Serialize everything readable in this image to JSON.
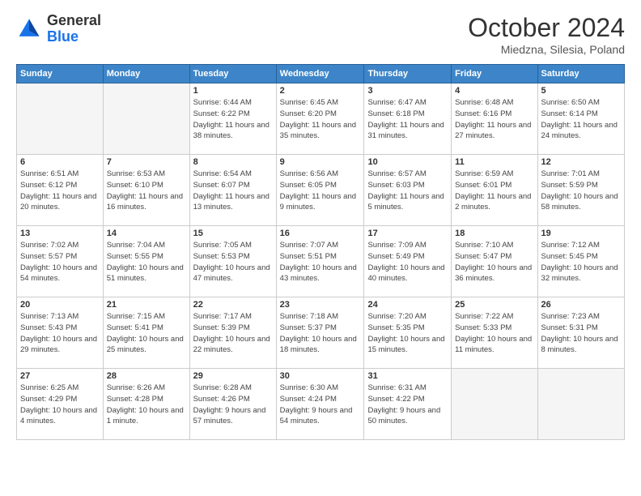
{
  "header": {
    "logo_general": "General",
    "logo_blue": "Blue",
    "month": "October 2024",
    "location": "Miedzna, Silesia, Poland"
  },
  "days_of_week": [
    "Sunday",
    "Monday",
    "Tuesday",
    "Wednesday",
    "Thursday",
    "Friday",
    "Saturday"
  ],
  "weeks": [
    [
      {
        "day": "",
        "empty": true
      },
      {
        "day": "",
        "empty": true
      },
      {
        "day": "1",
        "sunrise": "Sunrise: 6:44 AM",
        "sunset": "Sunset: 6:22 PM",
        "daylight": "Daylight: 11 hours and 38 minutes."
      },
      {
        "day": "2",
        "sunrise": "Sunrise: 6:45 AM",
        "sunset": "Sunset: 6:20 PM",
        "daylight": "Daylight: 11 hours and 35 minutes."
      },
      {
        "day": "3",
        "sunrise": "Sunrise: 6:47 AM",
        "sunset": "Sunset: 6:18 PM",
        "daylight": "Daylight: 11 hours and 31 minutes."
      },
      {
        "day": "4",
        "sunrise": "Sunrise: 6:48 AM",
        "sunset": "Sunset: 6:16 PM",
        "daylight": "Daylight: 11 hours and 27 minutes."
      },
      {
        "day": "5",
        "sunrise": "Sunrise: 6:50 AM",
        "sunset": "Sunset: 6:14 PM",
        "daylight": "Daylight: 11 hours and 24 minutes."
      }
    ],
    [
      {
        "day": "6",
        "sunrise": "Sunrise: 6:51 AM",
        "sunset": "Sunset: 6:12 PM",
        "daylight": "Daylight: 11 hours and 20 minutes."
      },
      {
        "day": "7",
        "sunrise": "Sunrise: 6:53 AM",
        "sunset": "Sunset: 6:10 PM",
        "daylight": "Daylight: 11 hours and 16 minutes."
      },
      {
        "day": "8",
        "sunrise": "Sunrise: 6:54 AM",
        "sunset": "Sunset: 6:07 PM",
        "daylight": "Daylight: 11 hours and 13 minutes."
      },
      {
        "day": "9",
        "sunrise": "Sunrise: 6:56 AM",
        "sunset": "Sunset: 6:05 PM",
        "daylight": "Daylight: 11 hours and 9 minutes."
      },
      {
        "day": "10",
        "sunrise": "Sunrise: 6:57 AM",
        "sunset": "Sunset: 6:03 PM",
        "daylight": "Daylight: 11 hours and 5 minutes."
      },
      {
        "day": "11",
        "sunrise": "Sunrise: 6:59 AM",
        "sunset": "Sunset: 6:01 PM",
        "daylight": "Daylight: 11 hours and 2 minutes."
      },
      {
        "day": "12",
        "sunrise": "Sunrise: 7:01 AM",
        "sunset": "Sunset: 5:59 PM",
        "daylight": "Daylight: 10 hours and 58 minutes."
      }
    ],
    [
      {
        "day": "13",
        "sunrise": "Sunrise: 7:02 AM",
        "sunset": "Sunset: 5:57 PM",
        "daylight": "Daylight: 10 hours and 54 minutes."
      },
      {
        "day": "14",
        "sunrise": "Sunrise: 7:04 AM",
        "sunset": "Sunset: 5:55 PM",
        "daylight": "Daylight: 10 hours and 51 minutes."
      },
      {
        "day": "15",
        "sunrise": "Sunrise: 7:05 AM",
        "sunset": "Sunset: 5:53 PM",
        "daylight": "Daylight: 10 hours and 47 minutes."
      },
      {
        "day": "16",
        "sunrise": "Sunrise: 7:07 AM",
        "sunset": "Sunset: 5:51 PM",
        "daylight": "Daylight: 10 hours and 43 minutes."
      },
      {
        "day": "17",
        "sunrise": "Sunrise: 7:09 AM",
        "sunset": "Sunset: 5:49 PM",
        "daylight": "Daylight: 10 hours and 40 minutes."
      },
      {
        "day": "18",
        "sunrise": "Sunrise: 7:10 AM",
        "sunset": "Sunset: 5:47 PM",
        "daylight": "Daylight: 10 hours and 36 minutes."
      },
      {
        "day": "19",
        "sunrise": "Sunrise: 7:12 AM",
        "sunset": "Sunset: 5:45 PM",
        "daylight": "Daylight: 10 hours and 32 minutes."
      }
    ],
    [
      {
        "day": "20",
        "sunrise": "Sunrise: 7:13 AM",
        "sunset": "Sunset: 5:43 PM",
        "daylight": "Daylight: 10 hours and 29 minutes."
      },
      {
        "day": "21",
        "sunrise": "Sunrise: 7:15 AM",
        "sunset": "Sunset: 5:41 PM",
        "daylight": "Daylight: 10 hours and 25 minutes."
      },
      {
        "day": "22",
        "sunrise": "Sunrise: 7:17 AM",
        "sunset": "Sunset: 5:39 PM",
        "daylight": "Daylight: 10 hours and 22 minutes."
      },
      {
        "day": "23",
        "sunrise": "Sunrise: 7:18 AM",
        "sunset": "Sunset: 5:37 PM",
        "daylight": "Daylight: 10 hours and 18 minutes."
      },
      {
        "day": "24",
        "sunrise": "Sunrise: 7:20 AM",
        "sunset": "Sunset: 5:35 PM",
        "daylight": "Daylight: 10 hours and 15 minutes."
      },
      {
        "day": "25",
        "sunrise": "Sunrise: 7:22 AM",
        "sunset": "Sunset: 5:33 PM",
        "daylight": "Daylight: 10 hours and 11 minutes."
      },
      {
        "day": "26",
        "sunrise": "Sunrise: 7:23 AM",
        "sunset": "Sunset: 5:31 PM",
        "daylight": "Daylight: 10 hours and 8 minutes."
      }
    ],
    [
      {
        "day": "27",
        "sunrise": "Sunrise: 6:25 AM",
        "sunset": "Sunset: 4:29 PM",
        "daylight": "Daylight: 10 hours and 4 minutes."
      },
      {
        "day": "28",
        "sunrise": "Sunrise: 6:26 AM",
        "sunset": "Sunset: 4:28 PM",
        "daylight": "Daylight: 10 hours and 1 minute."
      },
      {
        "day": "29",
        "sunrise": "Sunrise: 6:28 AM",
        "sunset": "Sunset: 4:26 PM",
        "daylight": "Daylight: 9 hours and 57 minutes."
      },
      {
        "day": "30",
        "sunrise": "Sunrise: 6:30 AM",
        "sunset": "Sunset: 4:24 PM",
        "daylight": "Daylight: 9 hours and 54 minutes."
      },
      {
        "day": "31",
        "sunrise": "Sunrise: 6:31 AM",
        "sunset": "Sunset: 4:22 PM",
        "daylight": "Daylight: 9 hours and 50 minutes."
      },
      {
        "day": "",
        "empty": true
      },
      {
        "day": "",
        "empty": true
      }
    ]
  ]
}
